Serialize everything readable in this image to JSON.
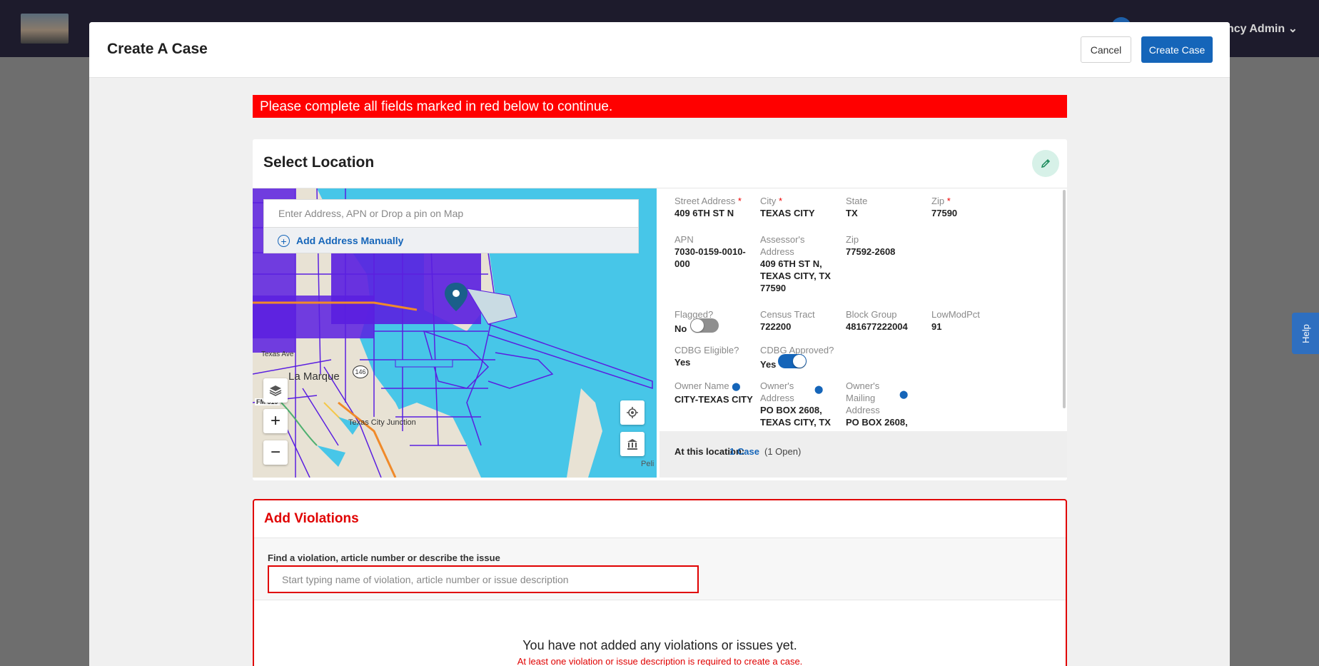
{
  "app": {
    "user_label": "ency Admin"
  },
  "help": {
    "label": "Help"
  },
  "modal": {
    "title": "Create A Case",
    "cancel_label": "Cancel",
    "create_label": "Create Case",
    "error_banner": "Please complete all fields marked in red below to continue."
  },
  "location": {
    "title": "Select Location",
    "address_placeholder": "Enter Address, APN or Drop a pin on Map",
    "add_manual_label": "Add Address Manually",
    "map_labels": {
      "la_marque": "La Marque",
      "texas_ave": "Texas Ave",
      "fm519": "FM 519",
      "texas_city": "Texas City Junction",
      "peli": "Peli",
      "road_146": "146"
    },
    "fields": {
      "street_address": {
        "label": "Street Address",
        "value": "409 6TH ST N"
      },
      "city": {
        "label": "City",
        "value": "TEXAS CITY"
      },
      "state": {
        "label": "State",
        "value": "TX"
      },
      "zip": {
        "label": "Zip",
        "value": "77590"
      },
      "apn": {
        "label": "APN",
        "value_l1": "7030-0159-0010-",
        "value_l2": "000"
      },
      "assessors_address": {
        "label_l1": "Assessor's",
        "label_l2": "Address",
        "value_l1": "409 6TH ST N,",
        "value_l2": "TEXAS CITY, TX",
        "value_l3": "77590"
      },
      "zip2": {
        "label": "Zip",
        "value": "77592-2608"
      },
      "flagged": {
        "label": "Flagged?",
        "value": "No",
        "on": false
      },
      "census_tract": {
        "label": "Census Tract",
        "value": "722200"
      },
      "block_group": {
        "label": "Block Group",
        "value": "481677222004"
      },
      "lowmodpct": {
        "label": "LowModPct",
        "value": "91"
      },
      "cdbg_eligible": {
        "label": "CDBG Eligible?",
        "value": "Yes"
      },
      "cdbg_approved": {
        "label": "CDBG Approved?",
        "value": "Yes",
        "on": true
      },
      "owner_name": {
        "label": "Owner Name",
        "value": "CITY-TEXAS CITY"
      },
      "owners_address": {
        "label_l1": "Owner's",
        "label_l2": "Address",
        "value_l1": "PO BOX 2608,",
        "value_l2": "TEXAS CITY, TX"
      },
      "owners_mailing": {
        "label_l1": "Owner's",
        "label_l2": "Mailing",
        "label_l3": "Address",
        "value_l1": "PO BOX 2608,"
      }
    },
    "footer": {
      "prefix": "At this location:",
      "cases_link": "1 Case",
      "open_count": "(1 Open)"
    }
  },
  "violations": {
    "title": "Add Violations",
    "search_label": "Find a violation, article number or describe the issue",
    "search_placeholder": "Start typing name of violation, article number or issue description",
    "empty_message": "You have not added any violations or issues yet.",
    "empty_sub": "At least one violation or issue description is required to create a case."
  },
  "colors": {
    "primary": "#1565b9",
    "error": "#ff0000",
    "parcel": "#5a1fe0",
    "water": "#47c6e8",
    "land": "#e8e2d4"
  }
}
